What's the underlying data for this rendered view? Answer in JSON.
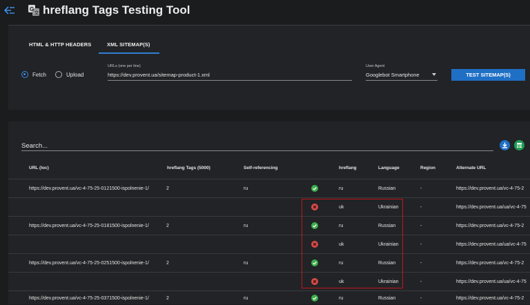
{
  "app": {
    "title": "hreflang Tags Testing Tool",
    "back_icon": "arrow-left-icon",
    "logo_icon": "translate-icon"
  },
  "tabs": [
    {
      "label": "HTML & HTTP HEADERS",
      "active": false
    },
    {
      "label": "XML SITEMAP(S)",
      "active": true
    }
  ],
  "source": {
    "options": [
      {
        "label": "Fetch",
        "selected": true
      },
      {
        "label": "Upload",
        "selected": false
      }
    ]
  },
  "urls": {
    "label": "URLs (one per line)",
    "value": "https://dev.provent.ua/sitemap-product-1.xml"
  },
  "user_agent": {
    "label": "User Agent",
    "value": "Googlebot Smartphone"
  },
  "test_button": "TEST SITEMAP(S)",
  "search": {
    "placeholder": "Search...",
    "download_icon": "download-icon",
    "sheets_icon": "google-sheets-icon"
  },
  "colors": {
    "accent": "#1f6fc5",
    "ok": "#3cae4a",
    "error": "#d84a4a",
    "highlight": "#c4161c",
    "sheets": "#1f9d55"
  },
  "table": {
    "headers": [
      "URL (loc)",
      "hreflang Tags (5000)",
      "Self-referencing",
      "hreflang",
      "Language",
      "Region",
      "Alternate URL"
    ],
    "rows": [
      {
        "loc": "https://dev.provent.ua/vc-4-75-25-0121500-ispolnenie-1/",
        "tags": "2",
        "self": "ru",
        "status": "ok",
        "hreflang": "ru",
        "language": "Russian",
        "region": "-",
        "alternate": "https://dev.provent.ua/vc-4-75-2"
      },
      {
        "loc": "",
        "tags": "",
        "self": "",
        "status": "error",
        "hreflang": "uk",
        "language": "Ukrainian",
        "region": "-",
        "alternate": "https://dev.provent.ua/ua/vc-4-75"
      },
      {
        "loc": "https://dev.provent.ua/vc-4-75-25-0181500-ispolnenie-1/",
        "tags": "2",
        "self": "ru",
        "status": "ok",
        "hreflang": "ru",
        "language": "Russian",
        "region": "-",
        "alternate": "https://dev.provent.ua/vc-4-75-2"
      },
      {
        "loc": "",
        "tags": "",
        "self": "",
        "status": "error",
        "hreflang": "uk",
        "language": "Ukrainian",
        "region": "-",
        "alternate": "https://dev.provent.ua/ua/vc-4-75"
      },
      {
        "loc": "https://dev.provent.ua/vc-4-75-25-0251500-ispolnenie-1/",
        "tags": "2",
        "self": "ru",
        "status": "ok",
        "hreflang": "ru",
        "language": "Russian",
        "region": "-",
        "alternate": "https://dev.provent.ua/vc-4-75-2"
      },
      {
        "loc": "",
        "tags": "",
        "self": "",
        "status": "error",
        "hreflang": "uk",
        "language": "Ukrainian",
        "region": "-",
        "alternate": "https://dev.provent.ua/ua/vc-4-75"
      },
      {
        "loc": "https://dev.provent.ua/vc-4-75-25-0371500-ispolnenie-1/",
        "tags": "2",
        "self": "ru",
        "status": "ok",
        "hreflang": "ru",
        "language": "Russian",
        "region": "-",
        "alternate": "https://dev.provent.ua/vc-4-75-2"
      }
    ]
  }
}
